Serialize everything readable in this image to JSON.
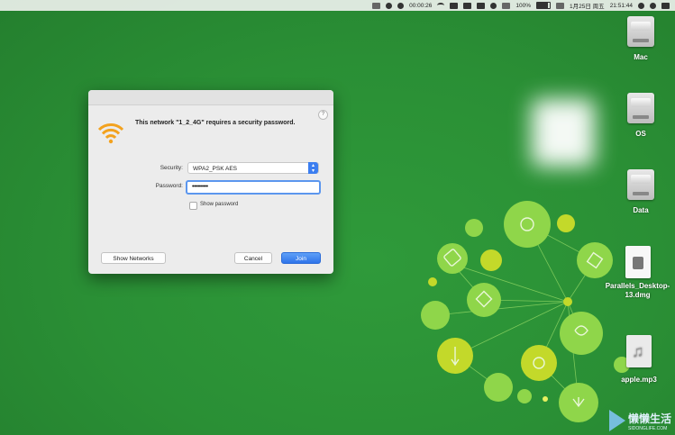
{
  "menubar": {
    "timer": "00:00:26",
    "battery": "100%",
    "date": "1月25日 周五",
    "time": "21:51:44"
  },
  "desktop_icons": [
    {
      "label": "Mac",
      "type": "drive"
    },
    {
      "label": "OS",
      "type": "drive"
    },
    {
      "label": "Data",
      "type": "drive"
    },
    {
      "label": "Parallels_Desktop-13.dmg",
      "type": "dmg"
    },
    {
      "label": "apple.mp3",
      "type": "audio"
    }
  ],
  "dialog": {
    "message": "This network \"1_2_4G\" requires a security password.",
    "security_label": "Security:",
    "security_value": "WPA2_PSK AES",
    "password_label": "Password:",
    "password_value": "•••••••••",
    "show_password_label": "Show password",
    "show_networks_button": "Show Networks",
    "cancel_button": "Cancel",
    "join_button": "Join",
    "help": "?"
  },
  "watermark": {
    "text": "懒懒生活",
    "sub": "SIDONGLIFE.COM"
  },
  "colors": {
    "desktop": "#2a8f35",
    "accent": "#2f74ea",
    "wifi": "#f3a21e",
    "bubble_light": "#8fd64a",
    "bubble_yellow": "#c3d92a"
  }
}
